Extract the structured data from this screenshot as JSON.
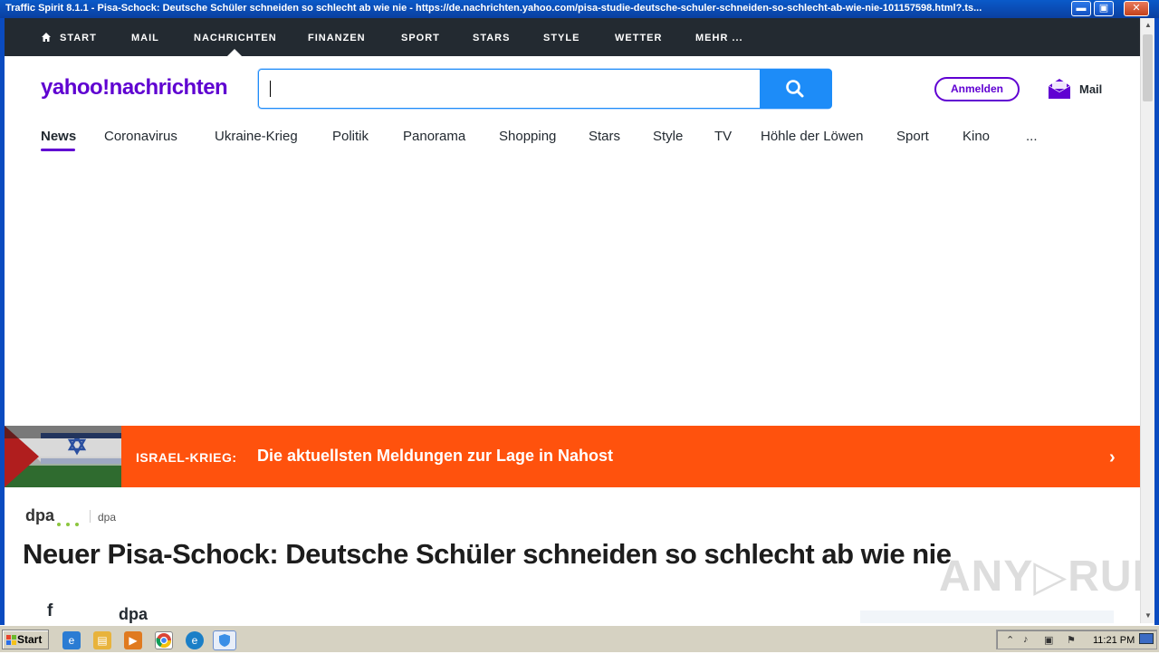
{
  "window": {
    "title": "Traffic Spirit 8.1.1 - Pisa-Schock: Deutsche Schüler schneiden so schlecht ab wie nie - https://de.nachrichten.yahoo.com/pisa-studie-deutsche-schuler-schneiden-so-schlecht-ab-wie-nie-101157598.html?.ts...",
    "minimize": "▬",
    "maximize": "▣",
    "close": "✕"
  },
  "topnav": {
    "items": [
      "START",
      "MAIL",
      "NACHRICHTEN",
      "FINANZEN",
      "SPORT",
      "STARS",
      "STYLE",
      "WETTER",
      "MEHR ..."
    ],
    "active": "NACHRICHTEN"
  },
  "header": {
    "logo": "yahoo!nachrichten",
    "search_value": "",
    "signin_label": "Anmelden",
    "mail_label": "Mail",
    "brand_color": "#6001d2",
    "search_color": "#1d8cf8"
  },
  "subnav": {
    "items": [
      "News",
      "Coronavirus",
      "Ukraine-Krieg",
      "Politik",
      "Panorama",
      "Shopping",
      "Stars",
      "Style",
      "TV",
      "Höhle der Löwen",
      "Sport",
      "Kino",
      "..."
    ],
    "active": "News"
  },
  "banner": {
    "tag": "ISRAEL-KRIEG:",
    "headline": "Die aktuellsten Meldungen zur Lage in Nahost",
    "color": "#ff520d"
  },
  "article": {
    "provider_logo": "dpa",
    "provider_name": "dpa",
    "title": "Neuer Pisa-Schock: Deutsche Schüler schneiden so schlecht ab wie nie",
    "author": "dpa",
    "share_icon": "facebook-icon"
  },
  "watermark": "ANY▷RUN",
  "taskbar": {
    "start_label": "Start",
    "clock": "11:21 PM",
    "apps": [
      "ie-icon",
      "explorer-icon",
      "media-player-icon",
      "chrome-icon",
      "edge-icon",
      "shield-app-icon"
    ]
  }
}
